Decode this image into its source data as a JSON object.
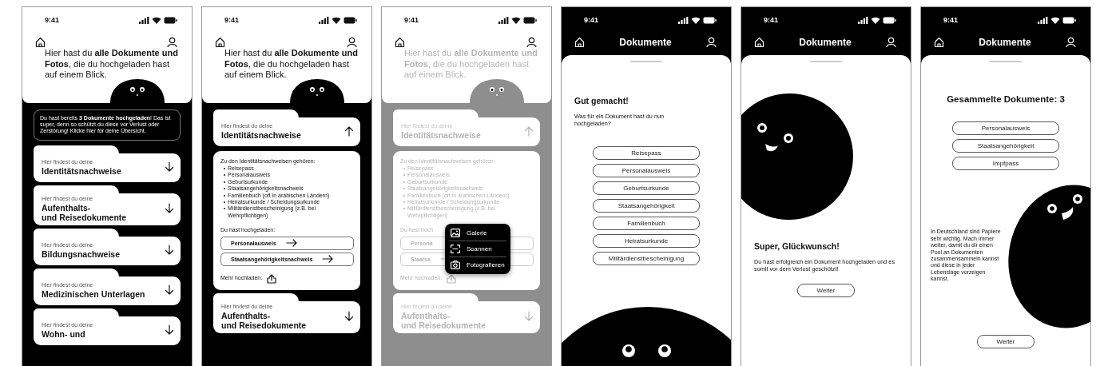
{
  "screens": [
    {
      "kind": "overview",
      "dimmed": false,
      "time": "9:41",
      "intro": "Hier hast du **alle Dokumente und Fotos**, die du hochgeladen hast auf einem Blick.",
      "notice": "Du hast bereits **3 Dokumente hochgeladen**! Das ist super, denn so schützt du diese vor Verlust oder Zerstörung! Klicke hier für deine Übersicht.",
      "categories": [
        {
          "caption": "Hier findest du deine",
          "title": "Identitätsnachweise",
          "expanded": false
        },
        {
          "caption": "Hier findest du deine",
          "title": "Aufenthalts-\nund Reisedokumente",
          "expanded": false
        },
        {
          "caption": "Hier findest du deine",
          "title": "Bildungsnachweise",
          "expanded": false
        },
        {
          "caption": "Hier findest du deine",
          "title": "Medizinischen Unterlagen",
          "expanded": false
        },
        {
          "caption": "Hier findest du deine",
          "title": "Wohn- und",
          "expanded": false
        }
      ]
    },
    {
      "kind": "overview",
      "dimmed": false,
      "time": "9:41",
      "intro": "Hier hast du **alle Dokumente und Fotos**, die du hochgeladen hast auf einem Blick.",
      "categories": [
        {
          "caption": "Hier findest du deine",
          "title": "Identitätsnachweise",
          "expanded": true,
          "details": {
            "heading": "Zu den Identitätsnachweisen gehören:",
            "items": [
              "Reisepass",
              "Personalausweis",
              "Geburtsurkunde",
              "Staatsangehörigkeitsnachweis",
              "Familienbuch (oft in arabischen Ländern)",
              "Heiratsurkunde / Scheidungsurkunde",
              "Militärdienstbescheinigung (z.B. bei Wehrpflichtigen)"
            ],
            "uploaded_label": "Du hast hochgeladen:",
            "uploaded": [
              {
                "label": "Personalausweis",
                "arrow": true
              },
              {
                "label": "Staatsangehörigkeitsnachweis",
                "arrow": true
              }
            ],
            "more_label": "Mehr hochladen:"
          }
        },
        {
          "caption": "Hier findest du deine",
          "title": "Aufenthalts-\nund Reisedokumente",
          "expanded": false
        }
      ]
    },
    {
      "kind": "overview",
      "dimmed": true,
      "time": "9:41",
      "intro": "Hier hast du **alle Dokumente und Fotos**, die du hochgeladen hast auf einem Blick.",
      "categories": [
        {
          "caption": "Hier findest du deine",
          "title": "Identitätsnachweise",
          "expanded": true,
          "details": {
            "heading": "Zu den Identitätsnachweisen gehören:",
            "items": [
              "Reisepass",
              "Personalausweis",
              "Geburtsurkunde",
              "Staatsangehörigkeitsnachweis",
              "Familienbuch (oft in arabischen Ländern)",
              "Heiratsurkunde / Scheidungsurkunde",
              "Militärdienstbescheinigung (z.B. bei Wehrpflichtigen)"
            ],
            "uploaded_label": "Du hast hoch",
            "uploaded": [
              {
                "label": "Persona",
                "arrow": false
              },
              {
                "label": "Staatsa",
                "arrow": true
              }
            ],
            "more_label": "Mehr hochladen:",
            "menu": [
              {
                "kind": "gallery",
                "label": "Galerie"
              },
              {
                "kind": "scan",
                "label": "Scannen"
              },
              {
                "kind": "camera",
                "label": "Fotografieren"
              }
            ]
          }
        },
        {
          "caption": "Hier findest du deine",
          "title": "Aufenthalts-\nund Reisedokumente",
          "expanded": false
        }
      ]
    },
    {
      "kind": "choice",
      "time": "9:41",
      "title": "Dokumente",
      "heading": "Gut gemacht!",
      "question": "Was für ein Dokument hast du nun hochgeladen?",
      "options": [
        "Reisepass",
        "Personalausweis",
        "Geburtsurkunde",
        "Staatsangehörigkeit",
        "Familienbuch",
        "Heiratsurkunde",
        "Militärdienstbescheinigung"
      ]
    },
    {
      "kind": "success",
      "time": "9:41",
      "title": "Dokumente",
      "heading": "Super, Glückwunsch!",
      "message": "Du hast erfolgreich ein Dokument hochgeladen und es somit vor dem Verlust geschützt!",
      "button": "Weiter"
    },
    {
      "kind": "collection",
      "time": "9:41",
      "title": "Dokumente",
      "heading": "Gesammelte Dokumente: 3",
      "documents": [
        "Personalausweis",
        "Staatsangehörigkeit",
        "Impfpass"
      ],
      "message": "In Deutschland sind Papiere sehr wichtig. Mach immer weiter, damit du dir einen Pool an Dokumenten zusammensammeln kannst und diese in jeder Lebenslage vorzeigen kannst.",
      "button": "Weiter"
    }
  ]
}
